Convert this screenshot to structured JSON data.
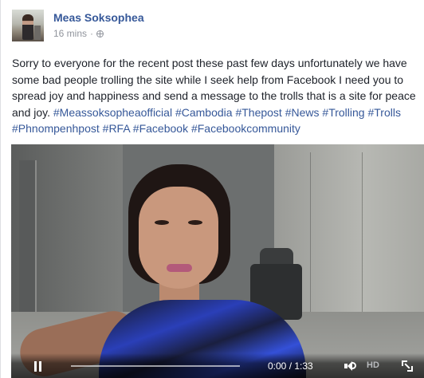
{
  "post": {
    "author": "Meas Soksophea",
    "timestamp": "16 mins",
    "separator": "·",
    "privacy_icon": "globe-icon",
    "message": "Sorry to everyone for the recent post these past few days unfortunately we have some bad people trolling the site while I seek help from Facebook I need you to spread joy and happiness and send a message to the trolls that is a site for peace and joy.",
    "hashtags": [
      "#Meassoksopheaofficial",
      "#Cambodia",
      "#Thepost",
      "#News",
      "#Trolling",
      "#Trolls",
      "#Phnompenhpost",
      "#RFA",
      "#Facebook",
      "#Facebookcommunity"
    ]
  },
  "video": {
    "time_display": "0:00 / 1:33",
    "quality_label": "HD",
    "progress": 0,
    "icons": {
      "pause": "pause-icon",
      "volume": "volume-icon",
      "fullscreen": "fullscreen-icon"
    }
  },
  "colors": {
    "author_link": "#365899",
    "hashtag": "#365899",
    "meta_text": "#90949c",
    "body_text": "#1d2129"
  }
}
